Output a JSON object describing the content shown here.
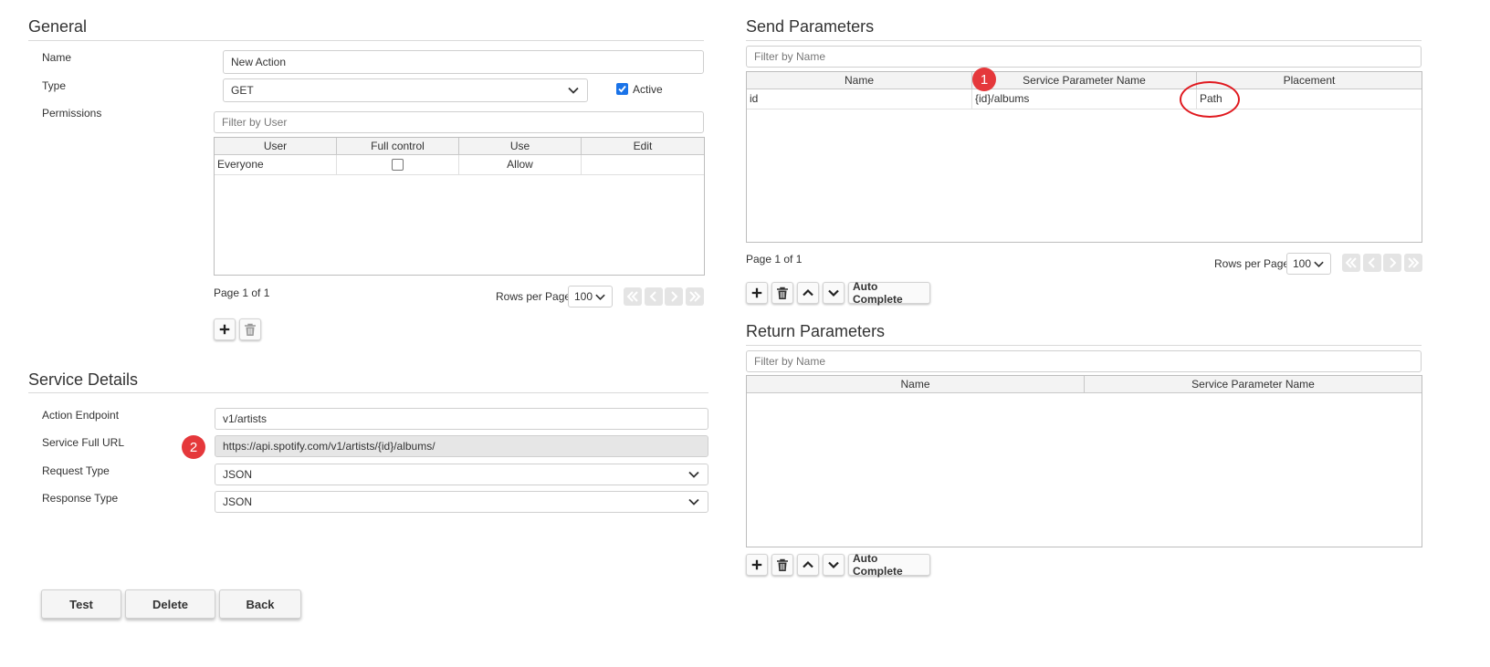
{
  "general": {
    "title": "General",
    "name_label": "Name",
    "name_value": "New Action",
    "type_label": "Type",
    "type_value": "GET",
    "active_label": "Active",
    "active_checked": true,
    "permissions_label": "Permissions",
    "filter_placeholder": "Filter by User",
    "grid_headers": [
      "User",
      "Full control",
      "Use",
      "Edit"
    ],
    "grid_rows": [
      {
        "user": "Everyone",
        "full_control": false,
        "use": "Allow",
        "edit": ""
      }
    ],
    "page_text": "Page 1 of 1",
    "rows_per_page_label": "Rows per Page",
    "rows_per_page_value": "100"
  },
  "service_details": {
    "title": "Service Details",
    "endpoint_label": "Action Endpoint",
    "endpoint_value": "v1/artists",
    "full_url_label": "Service Full URL",
    "full_url_value": "https://api.spotify.com/v1/artists/{id}/albums/",
    "request_type_label": "Request Type",
    "request_type_value": "JSON",
    "response_type_label": "Response Type",
    "response_type_value": "JSON"
  },
  "send_parameters": {
    "title": "Send Parameters",
    "filter_placeholder": "Filter by Name",
    "grid_headers": [
      "Name",
      "Service Parameter Name",
      "Placement"
    ],
    "grid_rows": [
      {
        "name": "id",
        "service_parameter_name": "{id}/albums",
        "placement": "Path"
      }
    ],
    "page_text": "Page 1 of 1",
    "rows_per_page_label": "Rows per Page",
    "rows_per_page_value": "100",
    "auto_complete_label": "Auto Complete"
  },
  "return_parameters": {
    "title": "Return Parameters",
    "filter_placeholder": "Filter by Name",
    "grid_headers": [
      "Name",
      "Service Parameter Name"
    ],
    "auto_complete_label": "Auto Complete"
  },
  "actions": {
    "test_label": "Test",
    "delete_label": "Delete",
    "back_label": "Back"
  },
  "annotations": {
    "marker_1": "1",
    "marker_2": "2"
  },
  "colors": {
    "accent": "#1a73e8",
    "marker": "#e5383b",
    "highlight_ellipse": "#e0191f"
  }
}
